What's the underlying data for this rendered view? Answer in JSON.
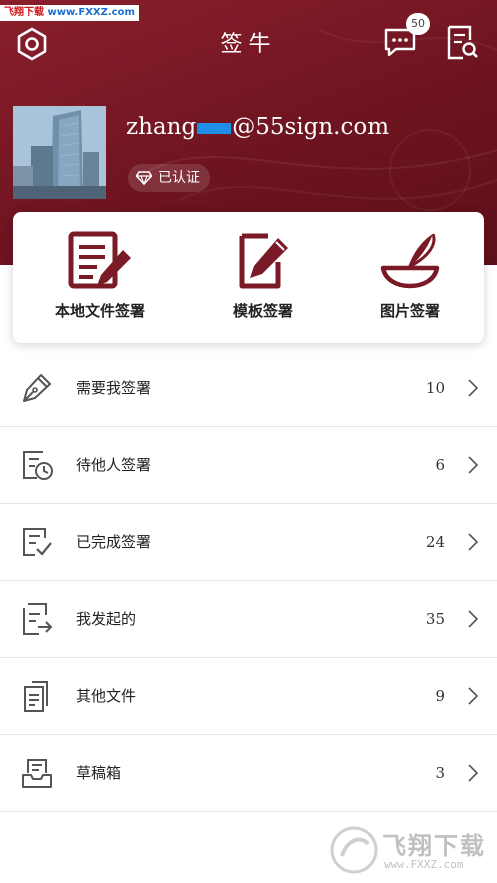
{
  "watermark_top": {
    "site": "飞翔下载",
    "url": "www.FXXZ.com"
  },
  "header": {
    "title": "签牛",
    "message_badge": "50",
    "user": {
      "email_prefix": "zhang",
      "email_suffix": "@55sign.com",
      "verified_label": "已认证"
    }
  },
  "quick_actions": [
    {
      "label": "本地文件签署",
      "icon": "document-pen-icon"
    },
    {
      "label": "模板签署",
      "icon": "template-edit-icon"
    },
    {
      "label": "图片签署",
      "icon": "quill-inkwell-icon"
    }
  ],
  "menu": [
    {
      "label": "需要我签署",
      "count": "10",
      "icon": "pen-nib-icon"
    },
    {
      "label": "待他人签署",
      "count": "6",
      "icon": "document-clock-icon"
    },
    {
      "label": "已完成签署",
      "count": "24",
      "icon": "document-check-icon"
    },
    {
      "label": "我发起的",
      "count": "35",
      "icon": "document-send-icon"
    },
    {
      "label": "其他文件",
      "count": "9",
      "icon": "documents-icon"
    },
    {
      "label": "草稿箱",
      "count": "3",
      "icon": "inbox-tray-icon"
    }
  ],
  "watermark_bottom": {
    "brand": "飞翔下载",
    "url": "www.FXXZ.com"
  },
  "colors": {
    "brand": "#7a1a26",
    "icon": "#555555",
    "mask": "#1e8ee8"
  }
}
